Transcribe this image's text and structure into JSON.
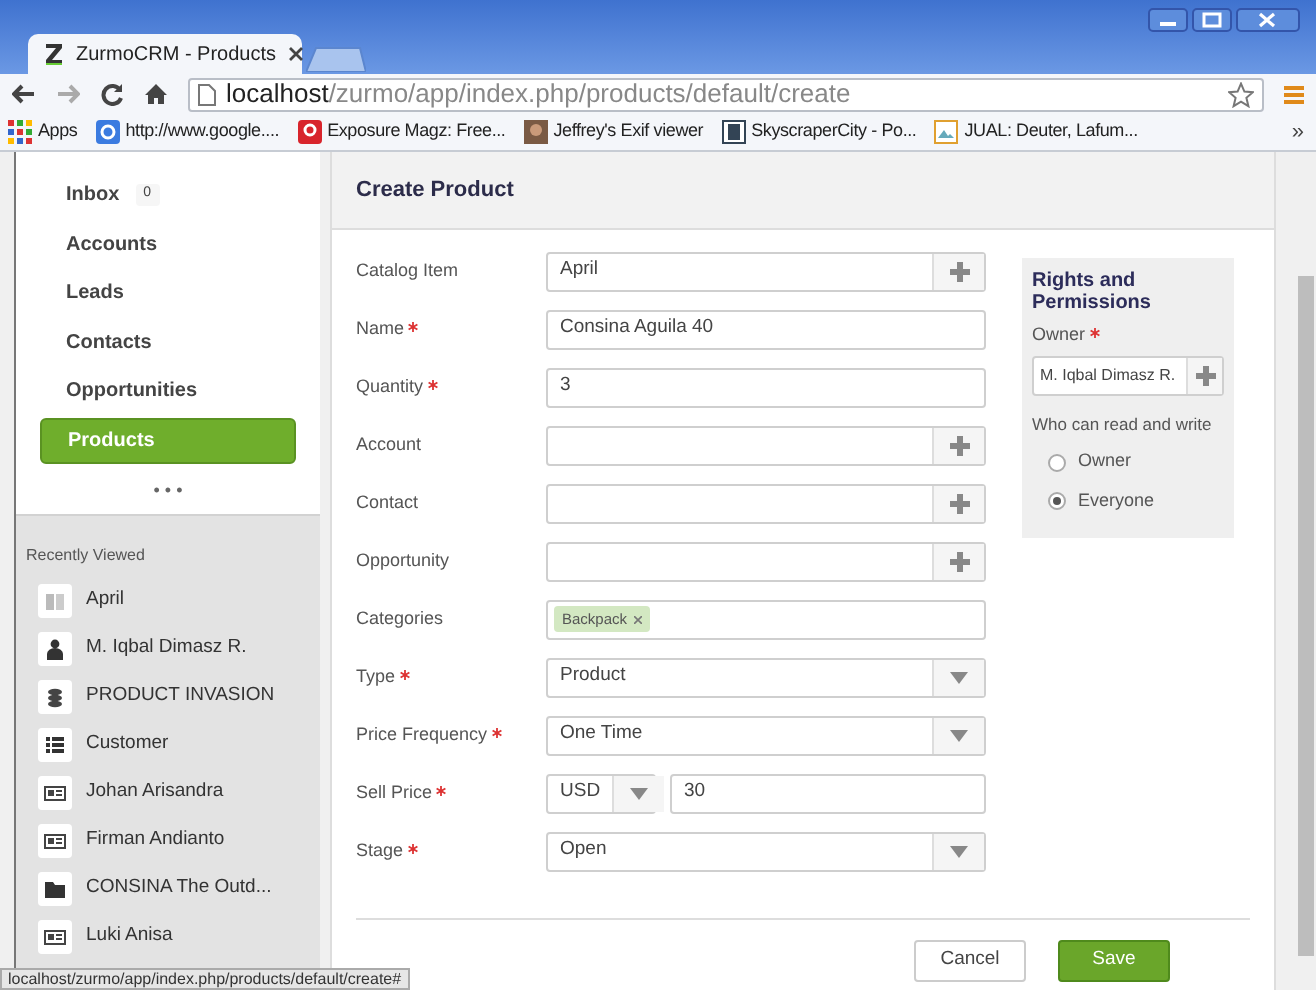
{
  "browser": {
    "tabs": [
      {
        "title": "ZurmoCRM - Products",
        "selected": true
      }
    ],
    "url": {
      "host": "localhost",
      "path": "/zurmo/app/index.php/products/default/create"
    },
    "bookmarks": [
      {
        "label": "Apps",
        "kind": "apps"
      },
      {
        "label": "http://www.google....",
        "kind": "google"
      },
      {
        "label": "Exposure Magz: Free...",
        "kind": "red"
      },
      {
        "label": "Jeffrey's Exif viewer",
        "kind": "photo"
      },
      {
        "label": "SkyscraperCity - Po...",
        "kind": "page"
      },
      {
        "label": "JUAL: Deuter, Lafum...",
        "kind": "image"
      }
    ],
    "more": "»"
  },
  "sidebar": {
    "nav": [
      {
        "label": "Inbox",
        "badge": "0",
        "selected": false
      },
      {
        "label": "Accounts",
        "selected": false
      },
      {
        "label": "Leads",
        "selected": false
      },
      {
        "label": "Contacts",
        "selected": false
      },
      {
        "label": "Opportunities",
        "selected": false
      },
      {
        "label": "Products",
        "selected": true
      }
    ],
    "more": "• • •",
    "recently_viewed": {
      "title": "Recently Viewed",
      "items": [
        {
          "label": "April",
          "kind": "catalog"
        },
        {
          "label": "M. Iqbal Dimasz R.",
          "kind": "person"
        },
        {
          "label": "PRODUCT INVASION",
          "kind": "stack"
        },
        {
          "label": "Customer",
          "kind": "list"
        },
        {
          "label": "Johan Arisandra",
          "kind": "card"
        },
        {
          "label": "Firman Andianto",
          "kind": "card"
        },
        {
          "label": "CONSINA The Outd...",
          "kind": "folder"
        },
        {
          "label": "Luki Anisa",
          "kind": "card"
        }
      ]
    }
  },
  "form": {
    "title": "Create Product",
    "fields": [
      {
        "label": "Catalog Item",
        "required": false,
        "kind": "lookup",
        "value": "April"
      },
      {
        "label": "Name",
        "required": true,
        "kind": "text",
        "value": "Consina Aguila 40"
      },
      {
        "label": "Quantity",
        "required": true,
        "kind": "text",
        "value": "3"
      },
      {
        "label": "Account",
        "required": false,
        "kind": "lookup"
      },
      {
        "label": "Contact",
        "required": false,
        "kind": "lookup"
      },
      {
        "label": "Opportunity",
        "required": false,
        "kind": "lookup"
      },
      {
        "label": "Categories",
        "required": false,
        "kind": "tags",
        "tags": [
          "Backpack"
        ]
      },
      {
        "label": "Type",
        "required": true,
        "kind": "select",
        "value": "Product"
      },
      {
        "label": "Price Frequency",
        "required": true,
        "kind": "select",
        "value": "One Time"
      },
      {
        "label": "Sell Price",
        "required": true,
        "kind": "currency",
        "currency": "USD",
        "value": "30"
      },
      {
        "label": "Stage",
        "required": true,
        "kind": "select",
        "value": "Open"
      }
    ],
    "buttons": [
      {
        "label": "Cancel",
        "kind": "secondary"
      },
      {
        "label": "Save",
        "kind": "primary"
      }
    ]
  },
  "permissions": {
    "title": "Rights and Permissions",
    "owner_label": "Owner",
    "owner_required": true,
    "owner": "M. Iqbal Dimasz R.",
    "access_label": "Who can read and write",
    "options": [
      {
        "label": "Owner",
        "selected": false
      },
      {
        "label": "Everyone",
        "selected": true
      }
    ]
  },
  "status_url": "localhost/zurmo/app/index.php/products/default/create#"
}
